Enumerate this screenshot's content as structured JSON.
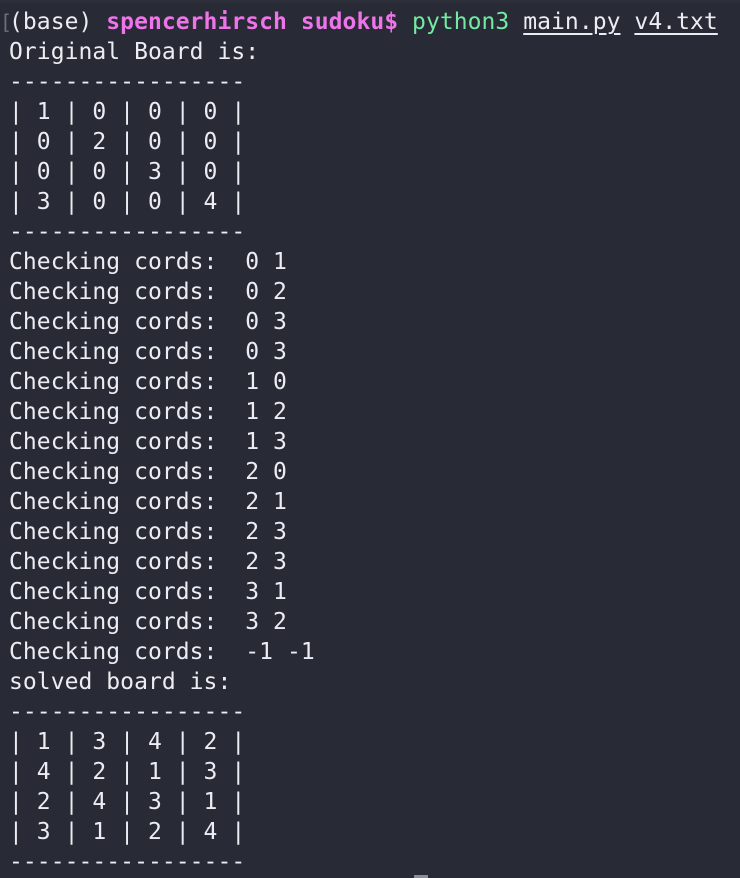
{
  "prompt": {
    "prefix": "(base) ",
    "user": "spencerhirsch",
    "cwd": "sudoku$",
    "command": "python3",
    "args": [
      "main.py",
      "v4.txt"
    ]
  },
  "lines": [
    "Original Board is:",
    "-----------------",
    "| 1 | 0 | 0 | 0 |",
    "| 0 | 2 | 0 | 0 |",
    "| 0 | 0 | 3 | 0 |",
    "| 3 | 0 | 0 | 4 |",
    "-----------------",
    "Checking cords:  0 1",
    "Checking cords:  0 2",
    "Checking cords:  0 3",
    "Checking cords:  0 3",
    "Checking cords:  1 0",
    "Checking cords:  1 2",
    "Checking cords:  1 3",
    "Checking cords:  2 0",
    "Checking cords:  2 1",
    "Checking cords:  2 3",
    "Checking cords:  2 3",
    "Checking cords:  3 1",
    "Checking cords:  3 2",
    "Checking cords:  -1 -1",
    "solved board is:",
    "-----------------",
    "| 1 | 3 | 4 | 2 |",
    "| 4 | 2 | 1 | 3 |",
    "| 2 | 4 | 3 | 1 |",
    "| 3 | 1 | 2 | 4 |",
    "-----------------"
  ],
  "colors": {
    "background": "#282a35",
    "text": "#ecedf2",
    "prompt_user": "#ee74ea",
    "command": "#73e9a2"
  }
}
